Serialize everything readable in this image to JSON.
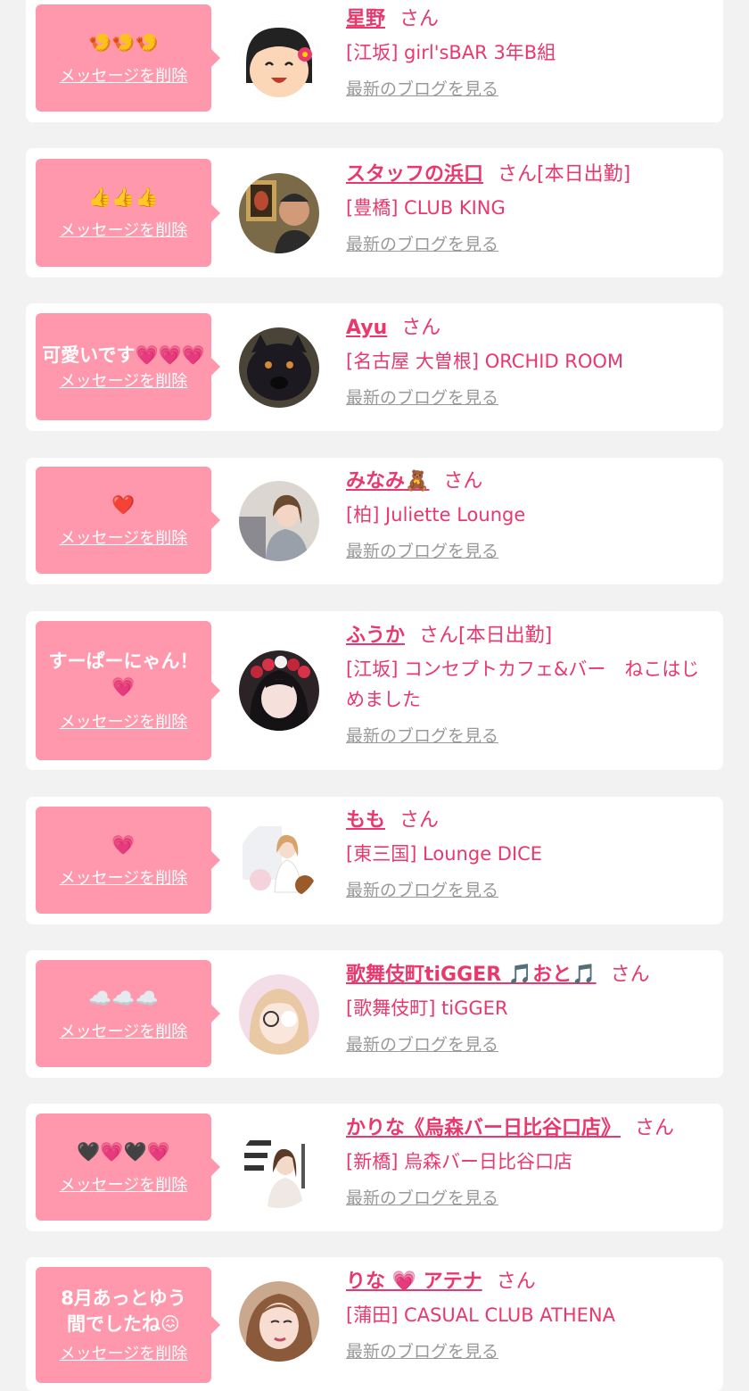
{
  "delete_label": "メッセージを削除",
  "blog_label": "最新のブログを見る",
  "honorific": "さん",
  "cards": [
    {
      "message": "🍤🍤🍤",
      "name": "星野",
      "status": "",
      "shop": "[江坂] girl'sBAR 3年B組"
    },
    {
      "message": "👍👍👍",
      "name": "スタッフの浜口",
      "status": "[本日出勤]",
      "shop": "[豊橋] CLUB KING"
    },
    {
      "message": "可愛いです💗💗💗",
      "name": "Ayu",
      "status": "",
      "shop": "[名古屋 大曽根] ORCHID ROOM"
    },
    {
      "message": "❤️",
      "name": "みなみ🧸",
      "status": "",
      "shop": "[柏] Juliette Lounge"
    },
    {
      "message": "すーぱーにゃん！💗",
      "name": "ふうか",
      "status": "[本日出勤]",
      "shop": "[江坂] コンセプトカフェ&バー　ねこはじめました"
    },
    {
      "message": "💗",
      "name": "もも",
      "status": "",
      "shop": "[東三国] Lounge DICE"
    },
    {
      "message": "☁️☁️☁️",
      "name": "歌舞伎町tiGGER 🎵おと🎵",
      "status": "",
      "shop": "[歌舞伎町] tiGGER"
    },
    {
      "message": "🖤💗🖤💗",
      "name": "かりな《烏森バー日比谷口店》",
      "status": "",
      "shop": "[新橋] 烏森バー日比谷口店"
    },
    {
      "message": "8月あっとゆう間でしたね😖",
      "name": "りな 💗 アテナ",
      "status": "",
      "shop": "[蒲田] CASUAL CLUB ATHENA"
    }
  ]
}
